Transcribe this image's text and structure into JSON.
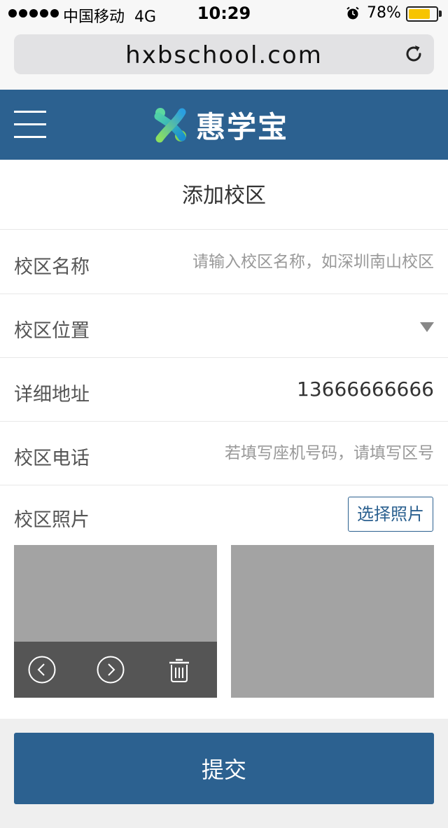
{
  "status_bar": {
    "carrier": "中国移动",
    "network": "4G",
    "time": "10:29",
    "battery_percent": "78%",
    "battery_level": 0.78
  },
  "browser": {
    "url": "hxbschool.com",
    "reload_icon": "reload-icon"
  },
  "header": {
    "menu_icon": "hamburger-menu-icon",
    "brand_name": "惠学宝",
    "color": "#2c6190"
  },
  "form": {
    "title": "添加校区",
    "fields": [
      {
        "label": "校区名称",
        "placeholder": "请输入校区名称，如深圳南山校区",
        "value": ""
      },
      {
        "label": "校区位置",
        "value": ""
      },
      {
        "label": "详细地址",
        "value": "13666666666"
      },
      {
        "label": "校区电话",
        "placeholder": "若填写座机号码，请填写区号",
        "value": ""
      }
    ],
    "photos": {
      "label": "校区照片",
      "choose_button": "选择照片",
      "control_icons": [
        "prev-icon",
        "next-icon",
        "trash-icon"
      ]
    },
    "submit_label": "提交"
  }
}
